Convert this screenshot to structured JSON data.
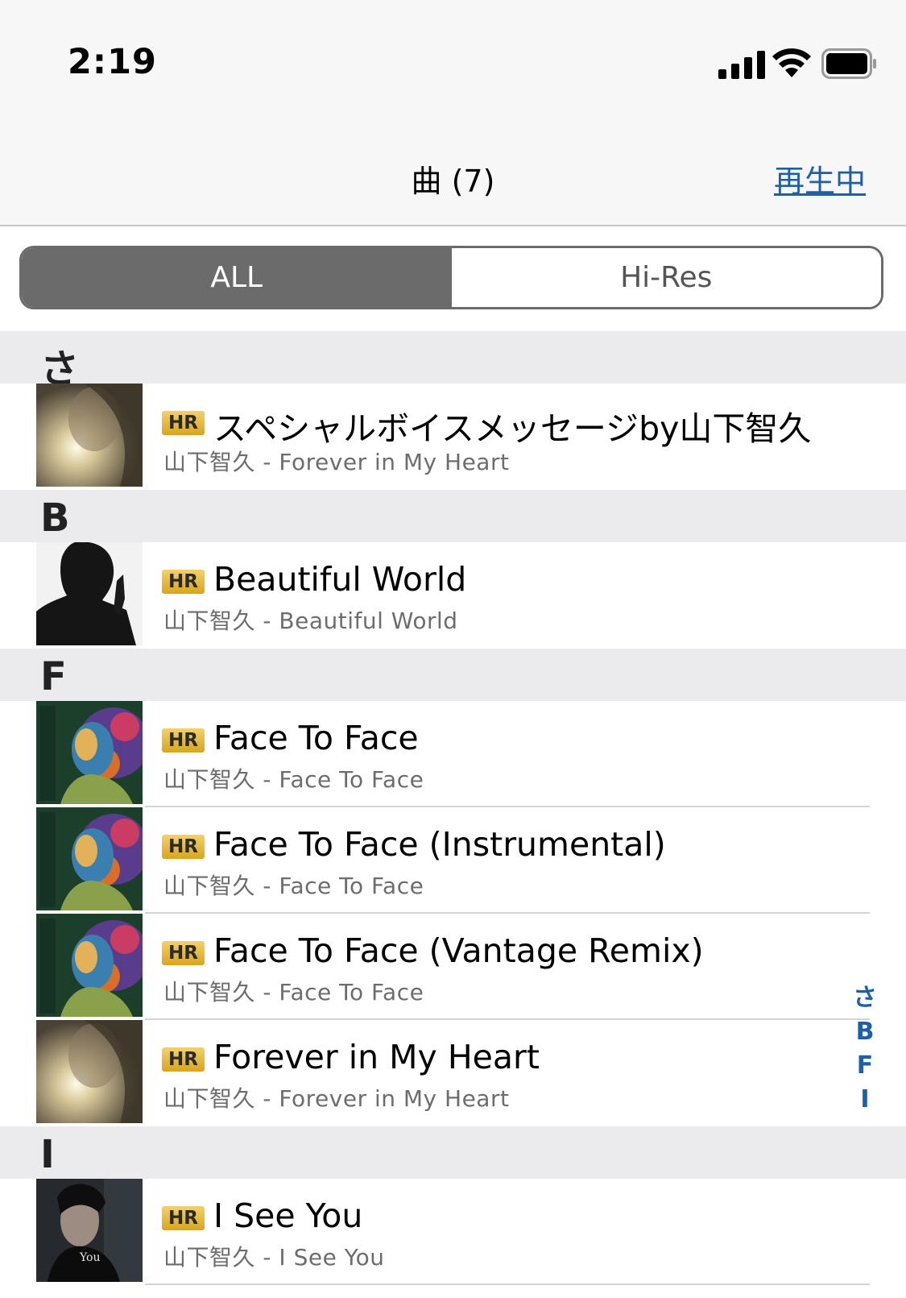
{
  "status_bar": {
    "time": "2:19",
    "icons": [
      "cellular-signal-icon",
      "wifi-icon",
      "battery-icon"
    ]
  },
  "nav": {
    "title": "曲 (7)",
    "right_link": "再生中"
  },
  "segments": [
    {
      "label": "ALL",
      "selected": true
    },
    {
      "label": "Hi-Res",
      "selected": false
    }
  ],
  "badge": "HR",
  "sections": [
    {
      "header": "さ",
      "songs": [
        {
          "title": "スペシャルボイスメッセージby山下智久",
          "subtitle": "山下智久 - Forever in My Heart",
          "art": "forever"
        }
      ]
    },
    {
      "header": "B",
      "songs": [
        {
          "title": "Beautiful World",
          "subtitle": "山下智久 - Beautiful World",
          "art": "beautiful"
        }
      ]
    },
    {
      "header": "F",
      "songs": [
        {
          "title": "Face To Face",
          "subtitle": "山下智久 - Face To Face",
          "art": "face"
        },
        {
          "title": "Face To Face (Instrumental)",
          "subtitle": "山下智久 - Face To Face",
          "art": "face"
        },
        {
          "title": "Face To Face (Vantage Remix)",
          "subtitle": "山下智久 - Face To Face",
          "art": "face"
        },
        {
          "title": "Forever in My Heart",
          "subtitle": "山下智久 - Forever in My Heart",
          "art": "forever"
        }
      ]
    },
    {
      "header": "I",
      "songs": [
        {
          "title": "I See You",
          "subtitle": "山下智久 - I See You",
          "art": "iseeyou"
        }
      ]
    }
  ],
  "index_letters": [
    "さ",
    "B",
    "F",
    "I"
  ],
  "colors": {
    "accent": "#1f5fa8",
    "segment_active": "#6b6b6b",
    "section_bg": "#ebebed",
    "badge": "#e8b832"
  }
}
